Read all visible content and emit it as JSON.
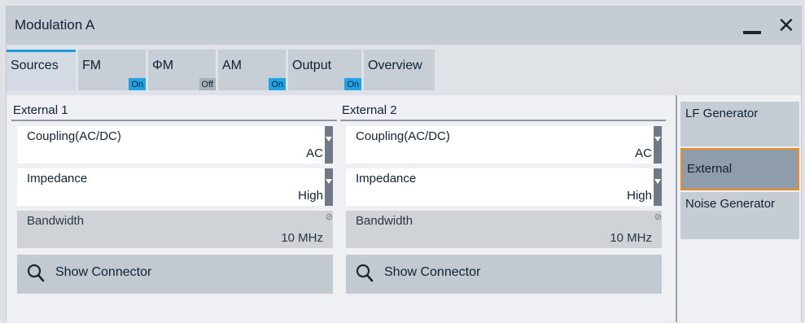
{
  "window": {
    "title": "Modulation A"
  },
  "tabs": [
    {
      "label": "Sources",
      "badge": "",
      "active": true
    },
    {
      "label": "FM",
      "badge": "On"
    },
    {
      "label": "ΦM",
      "badge": "Off"
    },
    {
      "label": "AM",
      "badge": "On"
    },
    {
      "label": "Output",
      "badge": "On"
    },
    {
      "label": "Overview",
      "badge": ""
    }
  ],
  "external1": {
    "title": "External 1",
    "coupling": {
      "label": "Coupling(AC/DC)",
      "value": "AC"
    },
    "impedance": {
      "label": "Impedance",
      "value": "High"
    },
    "bandwidth": {
      "label": "Bandwidth",
      "value": "10 MHz"
    },
    "show_connector": "Show Connector"
  },
  "external2": {
    "title": "External 2",
    "coupling": {
      "label": "Coupling(AC/DC)",
      "value": "AC"
    },
    "impedance": {
      "label": "Impedance",
      "value": "High"
    },
    "bandwidth": {
      "label": "Bandwidth",
      "value": "10 MHz"
    },
    "show_connector": "Show Connector"
  },
  "sidebar": {
    "items": [
      {
        "label": "LF Generator"
      },
      {
        "label": "External",
        "selected": true
      },
      {
        "label": "Noise Generator"
      }
    ]
  },
  "colors": {
    "accent": "#1ea3e6",
    "selected_border": "#f08a1c",
    "titlebar": "#c6ccd4"
  },
  "icons": {
    "minimize": "minimize-icon",
    "close": "close-icon",
    "search": "magnifier-icon",
    "disabled": "no-entry-icon"
  }
}
